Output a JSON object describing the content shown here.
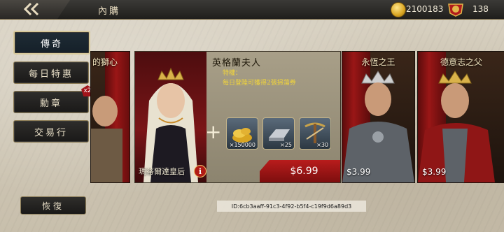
{
  "header": {
    "title": "內購",
    "coins": "2100183",
    "medals": "138"
  },
  "sidebar": {
    "items": [
      {
        "label": "傳奇"
      },
      {
        "label": "每日特惠"
      },
      {
        "label": "勳章",
        "badge": "x2"
      },
      {
        "label": "交易行"
      }
    ],
    "restore_label": "恢復"
  },
  "cards": {
    "left_partial_name": "的獅心",
    "featured": {
      "title": "英格蘭夫人",
      "perk_label": "特權：",
      "perk_desc": "每日登陸可獲得2張掃蕩券",
      "character_name": "瑪蒂爾達皇后",
      "price": "$6.99",
      "items": [
        {
          "name": "gold-coins",
          "qty": "×150000"
        },
        {
          "name": "iron-ingots",
          "qty": "×25"
        },
        {
          "name": "crossbow",
          "qty": "×30"
        }
      ]
    },
    "others": [
      {
        "name": "永恆之王",
        "price": "$3.99"
      },
      {
        "name": "德意志之父",
        "price": "$3.99"
      }
    ]
  },
  "footer": {
    "id_text": "ID:6cb3aaff-91c3-4f92-b5f4-c19f9d6a89d3"
  },
  "colors": {
    "accent_red": "#b81c1c",
    "perk_yellow": "#f2d53a",
    "active_tab": "#152029"
  }
}
